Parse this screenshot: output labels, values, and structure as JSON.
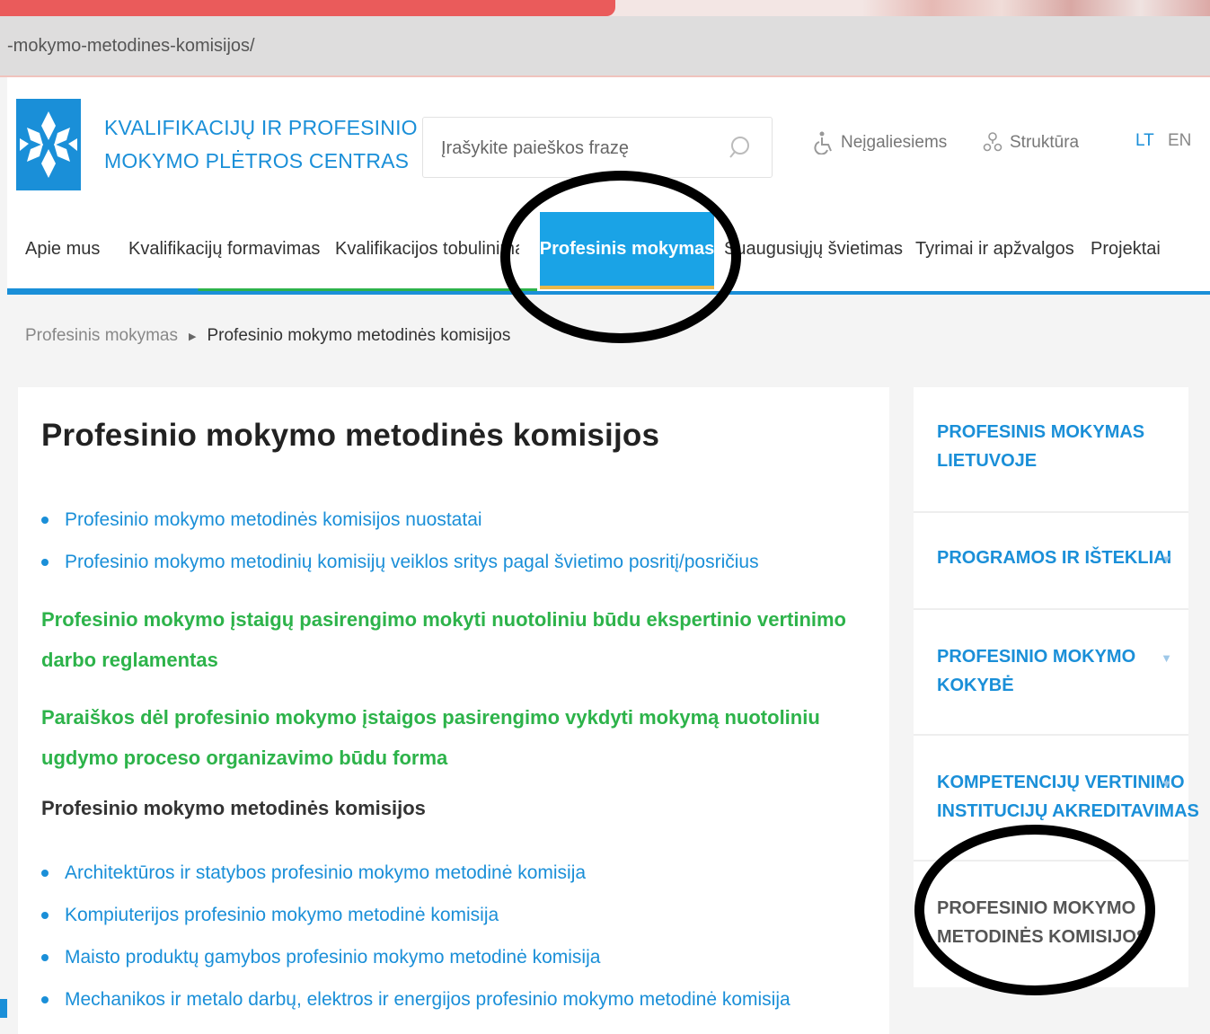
{
  "browser": {
    "url": "-mokymo-metodines-komisijos/"
  },
  "header": {
    "brand_line1": "KVALIFIKACIJŲ IR PROFESINIO",
    "brand_line2": "MOKYMO PLĖTROS CENTRAS",
    "search_placeholder": "Įrašykite paieškos frazę",
    "disabled_link": "Neįgaliesiems",
    "structure_link": "Struktūra",
    "lang_lt": "LT",
    "lang_en": "EN"
  },
  "nav": {
    "items": [
      "Apie mus",
      "Kvalifikacijų formavimas",
      "Kvalifikacijos tobulinima",
      "Profesinis mokymas",
      "Suaugusiųjų švietimas",
      "Tyrimai ir apžvalgos",
      "Projektai"
    ]
  },
  "breadcrumb": {
    "parent": "Profesinis mokymas",
    "current": "Profesinio mokymo metodinės komisijos"
  },
  "main": {
    "title": "Profesinio mokymo metodinės komisijos",
    "links_top": [
      "Profesinio mokymo metodinės komisijos nuostatai",
      "Profesinio mokymo metodinių komisijų veiklos sritys pagal švietimo posritį/posričius"
    ],
    "green_1": "Profesinio mokymo įstaigų pasirengimo mokyti nuotoliniu būdu ekspertinio vertinimo darbo reglamentas",
    "green_2": "Paraiškos dėl profesinio mokymo įstaigos pasirengimo vykdyti mokymą nuotoliniu ugdymo proceso organizavimo būdu forma",
    "subheading": "Profesinio mokymo metodinės komisijos",
    "links_bottom": [
      "Architektūros ir statybos profesinio mokymo metodinė komisija",
      "Kompiuterijos profesinio mokymo metodinė komisija",
      "Maisto produktų gamybos profesinio mokymo metodinė komisija",
      "Mechanikos ir metalo darbų, elektros ir energijos profesinio mokymo metodinė komisija"
    ]
  },
  "sidebar": {
    "items": [
      {
        "line1": "PROFESINIS MOKYMAS",
        "line2": "LIETUVOJE"
      },
      {
        "line1": "PROGRAMOS IR IŠTEKLIAI",
        "line2": ""
      },
      {
        "line1": "PROFESINIO MOKYMO",
        "line2": "KOKYBĖ"
      },
      {
        "line1": "KOMPETENCIJŲ VERTINIMO",
        "line2": "INSTITUCIJŲ AKREDITAVIMAS"
      },
      {
        "line1": "PROFESINIO MOKYMO",
        "line2": "METODINĖS KOMISIJOS"
      }
    ]
  },
  "colors": {
    "brand_blue": "#1a8fd8",
    "active_tab": "#1aa3e6",
    "link_green": "#2db34a",
    "annotation": "#000000"
  }
}
